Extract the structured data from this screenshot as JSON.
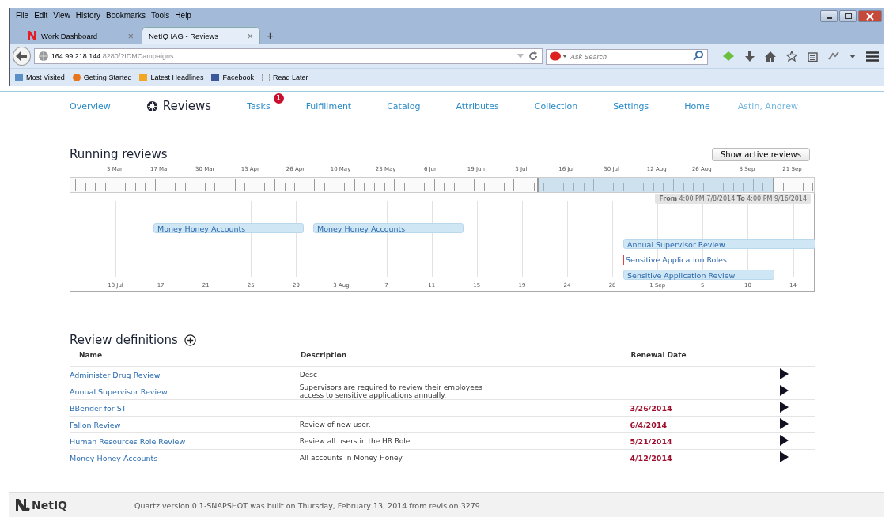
{
  "browser": {
    "menu": [
      "File",
      "Edit",
      "View",
      "History",
      "Bookmarks",
      "Tools",
      "Help"
    ],
    "tabs": [
      {
        "title": "Work Dashboard",
        "selected": false,
        "close": "×"
      },
      {
        "title": "NetIQ IAG - Reviews",
        "selected": true,
        "close": "×"
      }
    ],
    "new_tab": "+",
    "url": {
      "host": "164.99.218.144",
      "rest": ":8280/?IDMCampaigns"
    },
    "search": {
      "placeholder": "Ask Search"
    },
    "bookmarks": [
      "Most Visited",
      "Getting Started",
      "Latest Headlines",
      "Facebook",
      "Read Later"
    ]
  },
  "nav": {
    "items": [
      {
        "label": "Overview",
        "selected": false
      },
      {
        "label": "Reviews",
        "selected": true
      },
      {
        "label": "Tasks",
        "selected": false,
        "badge": "1"
      },
      {
        "label": "Fulfillment",
        "selected": false
      },
      {
        "label": "Catalog",
        "selected": false
      },
      {
        "label": "Attributes",
        "selected": false
      },
      {
        "label": "Collection",
        "selected": false
      },
      {
        "label": "Settings",
        "selected": false
      },
      {
        "label": "Home",
        "selected": false
      }
    ],
    "user": "Astin, Andrew"
  },
  "running": {
    "title": "Running reviews",
    "button": "Show active reviews",
    "top_ticks": [
      "3 Mar",
      "17 Mar",
      "30 Mar",
      "13 Apr",
      "26 Apr",
      "10 May",
      "23 May",
      "6 Jun",
      "19 Jun",
      "3 Jul",
      "16 Jul",
      "30 Jul",
      "12 Aug",
      "26 Aug",
      "8 Sep",
      "21 Sep"
    ],
    "bottom_ticks": [
      "13 Jul",
      "17",
      "21",
      "25",
      "29",
      "3 Aug",
      "7",
      "11",
      "15",
      "19",
      "24",
      "28",
      "1 Sep",
      "5",
      "10",
      "14"
    ],
    "range_label": "**From** 4:00 PM 7/8/2014 **To** 4:00 PM 9/16/2014",
    "bars": [
      {
        "label": "Money Honey Accounts",
        "kind": "bar"
      },
      {
        "label": "Money Honey Accounts",
        "kind": "bar"
      },
      {
        "label": "Annual Supervisor Review",
        "kind": "bar"
      },
      {
        "label": "Sensitive Application Roles",
        "kind": "marker"
      },
      {
        "label": "Sensitive Application Review",
        "kind": "bar"
      }
    ]
  },
  "definitions": {
    "title": "Review definitions",
    "columns": [
      "Name",
      "Description",
      "Renewal Date"
    ],
    "rows": [
      {
        "name": "Administer Drug Review",
        "description": "Desc"
      },
      {
        "name": "Annual Supervisor Review",
        "description": "Supervisors are required to review their employees access to sensitive applications annually."
      },
      {
        "name": "BBender for ST",
        "renewal": "3/26/2014"
      },
      {
        "name": "Fallon Review",
        "description": "Review of new user.",
        "renewal": "6/4/2014"
      },
      {
        "name": "Human Resources Role Review",
        "description": "Review all users in the HR Role",
        "renewal": "5/21/2014"
      },
      {
        "name": "Money Honey Accounts",
        "description": "All accounts in Money Honey",
        "renewal": "4/12/2014"
      }
    ]
  },
  "footer": {
    "logo": "NetIQ",
    "text": "Quartz version 0.1-SNAPSHOT was built on Thursday, February 13, 2014 from revision 3279"
  }
}
